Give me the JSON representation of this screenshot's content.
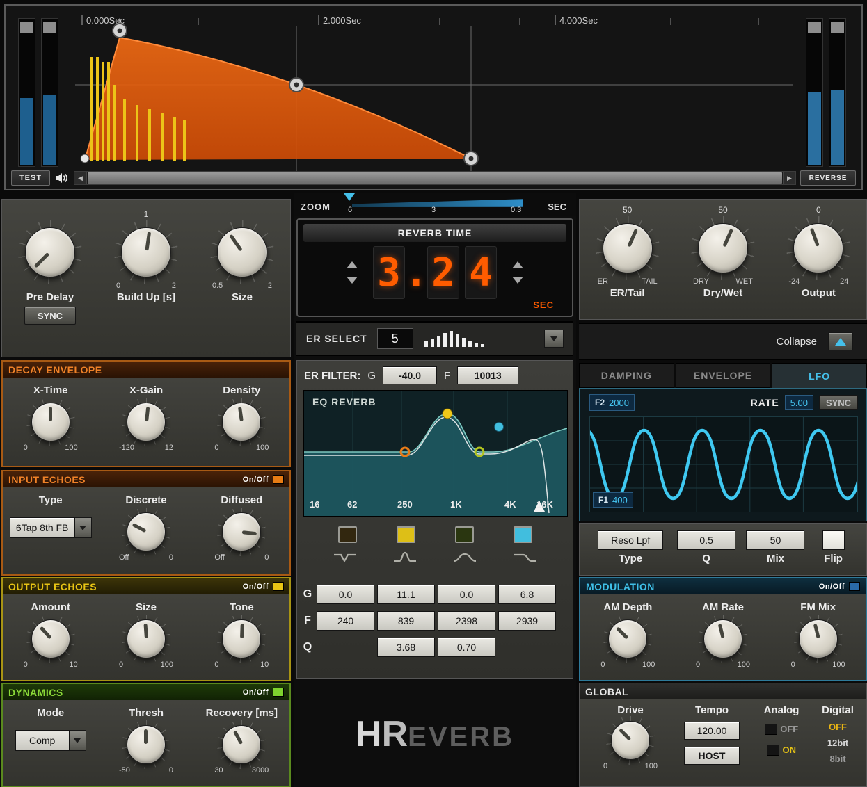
{
  "colors": {
    "accent_orange": "#e8641a",
    "accent_yellow": "#e8c414",
    "accent_green": "#7ed32e",
    "accent_cyan": "#3fc0e8",
    "digit_orange": "#ff5c00",
    "meter_blue": "#1e5f8e"
  },
  "transport": {
    "test": "TEST",
    "reverse": "REVERSE",
    "time_labels": [
      "0.000Sec",
      "2.000Sec",
      "4.000Sec"
    ]
  },
  "zoom": {
    "label": "ZOOM",
    "t1": "6",
    "t2": "3",
    "t3": "0.3",
    "unit": "SEC"
  },
  "predelay": {
    "label": "Pre Delay",
    "sync": "SYNC"
  },
  "buildup": {
    "label": "Build Up [s]",
    "value": "1",
    "min": "0",
    "max": "2"
  },
  "size": {
    "label": "Size",
    "min": "0.5",
    "max": "2"
  },
  "decay": {
    "title": "DECAY ENVELOPE",
    "k1": {
      "label": "X-Time",
      "min": "0",
      "max": "100"
    },
    "k2": {
      "label": "X-Gain",
      "min": "-120",
      "max": "12"
    },
    "k3": {
      "label": "Density",
      "min": "0",
      "max": "100"
    }
  },
  "input_echoes": {
    "title": "INPUT ECHOES",
    "onoff": "On/Off",
    "type_label": "Type",
    "type_value": "6Tap 8th FB",
    "k1": {
      "label": "Discrete",
      "min": "Off",
      "max": "0"
    },
    "k2": {
      "label": "Diffused",
      "min": "Off",
      "max": "0"
    }
  },
  "output_echoes": {
    "title": "OUTPUT ECHOES",
    "onoff": "On/Off",
    "k1": {
      "label": "Amount",
      "min": "0",
      "max": "10"
    },
    "k2": {
      "label": "Size",
      "min": "0",
      "max": "100"
    },
    "k3": {
      "label": "Tone",
      "min": "0",
      "max": "10"
    }
  },
  "dynamics": {
    "title": "DYNAMICS",
    "onoff": "On/Off",
    "mode_label": "Mode",
    "mode_value": "Comp",
    "k1": {
      "label": "Thresh",
      "min": "-50",
      "max": "0"
    },
    "k2": {
      "label": "Recovery [ms]",
      "min": "30",
      "max": "3000"
    }
  },
  "reverb_time": {
    "title": "REVERB TIME",
    "d1": "3",
    "dot": ".",
    "d2": "2",
    "d3": "4",
    "unit": "SEC"
  },
  "er_select": {
    "label": "ER SELECT",
    "value": "5"
  },
  "er_filter": {
    "label": "ER FILTER:",
    "g": "G",
    "g_value": "-40.0",
    "f": "F",
    "f_value": "10013",
    "eq_title": "EQ REVERB",
    "freqs": [
      "16",
      "62",
      "250",
      "1K",
      "4K",
      "16K"
    ],
    "row_g": "G",
    "row_f": "F",
    "row_q": "Q",
    "g_values": [
      "0.0",
      "11.1",
      "0.0",
      "6.8"
    ],
    "f_values": [
      "240",
      "839",
      "2398",
      "2939"
    ],
    "q_values": [
      "3.68",
      "0.70"
    ]
  },
  "logo": {
    "h": "H",
    "r": "R",
    "rest": "EVERB"
  },
  "ertail": {
    "label": "ER/Tail",
    "value": "50",
    "min": "ER",
    "max": "TAIL"
  },
  "drywet": {
    "label": "Dry/Wet",
    "value": "50",
    "min": "DRY",
    "max": "WET"
  },
  "outknob": {
    "label": "Output",
    "value": "0",
    "min": "-24",
    "max": "24"
  },
  "collapse": {
    "label": "Collapse"
  },
  "tabs": {
    "t1": "DAMPING",
    "t2": "ENVELOPE",
    "t3": "LFO"
  },
  "lfo": {
    "f2": "F2",
    "f2_value": "2000",
    "rate": "RATE",
    "rate_value": "5.00",
    "sync": "SYNC",
    "f1": "F1",
    "f1_value": "400"
  },
  "filter_row": {
    "type_value": "Reso Lpf",
    "type": "Type",
    "q_value": "0.5",
    "q": "Q",
    "mix_value": "50",
    "mix": "Mix",
    "flip": "Flip"
  },
  "modulation": {
    "title": "MODULATION",
    "onoff": "On/Off",
    "k1": {
      "label": "AM Depth",
      "min": "0",
      "max": "100"
    },
    "k2": {
      "label": "AM Rate",
      "min": "0",
      "max": "100"
    },
    "k3": {
      "label": "FM Mix",
      "min": "0",
      "max": "100"
    }
  },
  "global": {
    "title": "GLOBAL",
    "drive": {
      "label": "Drive",
      "min": "0",
      "max": "100"
    },
    "tempo_label": "Tempo",
    "tempo_value": "120.00",
    "host": "HOST",
    "analog_label": "Analog",
    "analog_off": "OFF",
    "analog_on": "ON",
    "digital_label": "Digital",
    "digital_off": "OFF",
    "digital_12": "12bit",
    "digital_8": "8bit"
  }
}
